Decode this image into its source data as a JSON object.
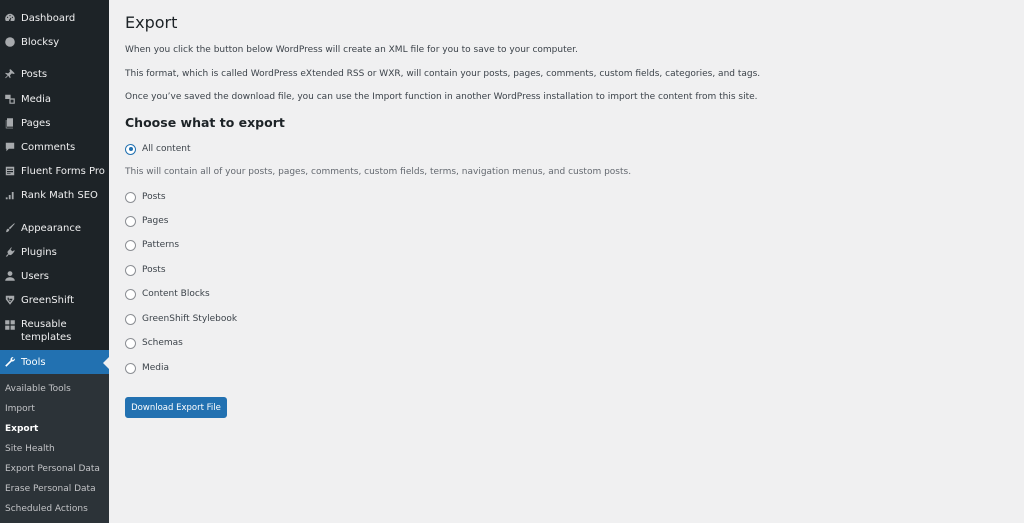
{
  "sidebar": {
    "items": [
      {
        "label": "Dashboard",
        "icon": "dashboard-icon"
      },
      {
        "label": "Blocksy",
        "icon": "blocksy-icon"
      },
      {
        "label": "Posts",
        "icon": "pin-icon"
      },
      {
        "label": "Media",
        "icon": "media-icon"
      },
      {
        "label": "Pages",
        "icon": "pages-icon"
      },
      {
        "label": "Comments",
        "icon": "comments-icon"
      },
      {
        "label": "Fluent Forms Pro",
        "icon": "forms-icon"
      },
      {
        "label": "Rank Math SEO",
        "icon": "rank-math-icon"
      },
      {
        "label": "Appearance",
        "icon": "brush-icon"
      },
      {
        "label": "Plugins",
        "icon": "plugin-icon"
      },
      {
        "label": "Users",
        "icon": "users-icon"
      },
      {
        "label": "GreenShift",
        "icon": "greenshift-icon"
      },
      {
        "label_line1": "Reusable",
        "label_line2": "templates",
        "icon": "grid-icon"
      },
      {
        "label": "Tools",
        "icon": "wrench-icon"
      }
    ],
    "submenu": [
      {
        "label": "Available Tools"
      },
      {
        "label": "Import"
      },
      {
        "label": "Export"
      },
      {
        "label": "Site Health"
      },
      {
        "label": "Export Personal Data"
      },
      {
        "label": "Erase Personal Data"
      },
      {
        "label": "Scheduled Actions"
      }
    ]
  },
  "main": {
    "title": "Export",
    "paragraphs": [
      "When you click the button below WordPress will create an XML file for you to save to your computer.",
      "This format, which is called WordPress eXtended RSS or WXR, will contain your posts, pages, comments, custom fields, categories, and tags.",
      "Once you’ve saved the download file, you can use the Import function in another WordPress installation to import the content from this site."
    ],
    "section_title": "Choose what to export",
    "options": [
      {
        "label": "All content",
        "checked": true
      },
      {
        "label": "Posts",
        "checked": false
      },
      {
        "label": "Pages",
        "checked": false
      },
      {
        "label": "Patterns",
        "checked": false
      },
      {
        "label": "Posts",
        "checked": false
      },
      {
        "label": "Content Blocks",
        "checked": false
      },
      {
        "label": "GreenShift Stylebook",
        "checked": false
      },
      {
        "label": "Schemas",
        "checked": false
      },
      {
        "label": "Media",
        "checked": false
      }
    ],
    "all_content_description": "This will contain all of your posts, pages, comments, custom fields, terms, navigation menus, and custom posts.",
    "button_label": "Download Export File"
  },
  "colors": {
    "sidebar_bg": "#1d2327",
    "submenu_bg": "#2c3338",
    "accent": "#2271b1",
    "page_bg": "#f0f0f1"
  }
}
